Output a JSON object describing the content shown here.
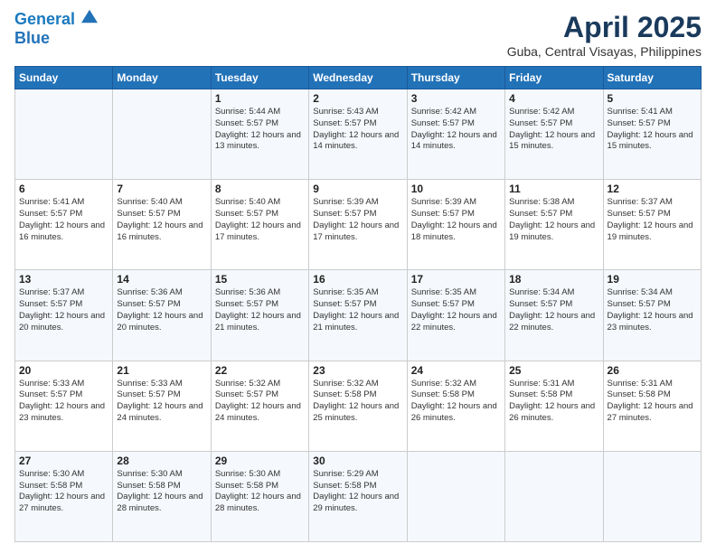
{
  "header": {
    "logo_line1": "General",
    "logo_line2": "Blue",
    "month_year": "April 2025",
    "location": "Guba, Central Visayas, Philippines"
  },
  "days_of_week": [
    "Sunday",
    "Monday",
    "Tuesday",
    "Wednesday",
    "Thursday",
    "Friday",
    "Saturday"
  ],
  "weeks": [
    [
      {
        "day": "",
        "sunrise": "",
        "sunset": "",
        "daylight": ""
      },
      {
        "day": "",
        "sunrise": "",
        "sunset": "",
        "daylight": ""
      },
      {
        "day": "1",
        "sunrise": "Sunrise: 5:44 AM",
        "sunset": "Sunset: 5:57 PM",
        "daylight": "Daylight: 12 hours and 13 minutes."
      },
      {
        "day": "2",
        "sunrise": "Sunrise: 5:43 AM",
        "sunset": "Sunset: 5:57 PM",
        "daylight": "Daylight: 12 hours and 14 minutes."
      },
      {
        "day": "3",
        "sunrise": "Sunrise: 5:42 AM",
        "sunset": "Sunset: 5:57 PM",
        "daylight": "Daylight: 12 hours and 14 minutes."
      },
      {
        "day": "4",
        "sunrise": "Sunrise: 5:42 AM",
        "sunset": "Sunset: 5:57 PM",
        "daylight": "Daylight: 12 hours and 15 minutes."
      },
      {
        "day": "5",
        "sunrise": "Sunrise: 5:41 AM",
        "sunset": "Sunset: 5:57 PM",
        "daylight": "Daylight: 12 hours and 15 minutes."
      }
    ],
    [
      {
        "day": "6",
        "sunrise": "Sunrise: 5:41 AM",
        "sunset": "Sunset: 5:57 PM",
        "daylight": "Daylight: 12 hours and 16 minutes."
      },
      {
        "day": "7",
        "sunrise": "Sunrise: 5:40 AM",
        "sunset": "Sunset: 5:57 PM",
        "daylight": "Daylight: 12 hours and 16 minutes."
      },
      {
        "day": "8",
        "sunrise": "Sunrise: 5:40 AM",
        "sunset": "Sunset: 5:57 PM",
        "daylight": "Daylight: 12 hours and 17 minutes."
      },
      {
        "day": "9",
        "sunrise": "Sunrise: 5:39 AM",
        "sunset": "Sunset: 5:57 PM",
        "daylight": "Daylight: 12 hours and 17 minutes."
      },
      {
        "day": "10",
        "sunrise": "Sunrise: 5:39 AM",
        "sunset": "Sunset: 5:57 PM",
        "daylight": "Daylight: 12 hours and 18 minutes."
      },
      {
        "day": "11",
        "sunrise": "Sunrise: 5:38 AM",
        "sunset": "Sunset: 5:57 PM",
        "daylight": "Daylight: 12 hours and 19 minutes."
      },
      {
        "day": "12",
        "sunrise": "Sunrise: 5:37 AM",
        "sunset": "Sunset: 5:57 PM",
        "daylight": "Daylight: 12 hours and 19 minutes."
      }
    ],
    [
      {
        "day": "13",
        "sunrise": "Sunrise: 5:37 AM",
        "sunset": "Sunset: 5:57 PM",
        "daylight": "Daylight: 12 hours and 20 minutes."
      },
      {
        "day": "14",
        "sunrise": "Sunrise: 5:36 AM",
        "sunset": "Sunset: 5:57 PM",
        "daylight": "Daylight: 12 hours and 20 minutes."
      },
      {
        "day": "15",
        "sunrise": "Sunrise: 5:36 AM",
        "sunset": "Sunset: 5:57 PM",
        "daylight": "Daylight: 12 hours and 21 minutes."
      },
      {
        "day": "16",
        "sunrise": "Sunrise: 5:35 AM",
        "sunset": "Sunset: 5:57 PM",
        "daylight": "Daylight: 12 hours and 21 minutes."
      },
      {
        "day": "17",
        "sunrise": "Sunrise: 5:35 AM",
        "sunset": "Sunset: 5:57 PM",
        "daylight": "Daylight: 12 hours and 22 minutes."
      },
      {
        "day": "18",
        "sunrise": "Sunrise: 5:34 AM",
        "sunset": "Sunset: 5:57 PM",
        "daylight": "Daylight: 12 hours and 22 minutes."
      },
      {
        "day": "19",
        "sunrise": "Sunrise: 5:34 AM",
        "sunset": "Sunset: 5:57 PM",
        "daylight": "Daylight: 12 hours and 23 minutes."
      }
    ],
    [
      {
        "day": "20",
        "sunrise": "Sunrise: 5:33 AM",
        "sunset": "Sunset: 5:57 PM",
        "daylight": "Daylight: 12 hours and 23 minutes."
      },
      {
        "day": "21",
        "sunrise": "Sunrise: 5:33 AM",
        "sunset": "Sunset: 5:57 PM",
        "daylight": "Daylight: 12 hours and 24 minutes."
      },
      {
        "day": "22",
        "sunrise": "Sunrise: 5:32 AM",
        "sunset": "Sunset: 5:57 PM",
        "daylight": "Daylight: 12 hours and 24 minutes."
      },
      {
        "day": "23",
        "sunrise": "Sunrise: 5:32 AM",
        "sunset": "Sunset: 5:58 PM",
        "daylight": "Daylight: 12 hours and 25 minutes."
      },
      {
        "day": "24",
        "sunrise": "Sunrise: 5:32 AM",
        "sunset": "Sunset: 5:58 PM",
        "daylight": "Daylight: 12 hours and 26 minutes."
      },
      {
        "day": "25",
        "sunrise": "Sunrise: 5:31 AM",
        "sunset": "Sunset: 5:58 PM",
        "daylight": "Daylight: 12 hours and 26 minutes."
      },
      {
        "day": "26",
        "sunrise": "Sunrise: 5:31 AM",
        "sunset": "Sunset: 5:58 PM",
        "daylight": "Daylight: 12 hours and 27 minutes."
      }
    ],
    [
      {
        "day": "27",
        "sunrise": "Sunrise: 5:30 AM",
        "sunset": "Sunset: 5:58 PM",
        "daylight": "Daylight: 12 hours and 27 minutes."
      },
      {
        "day": "28",
        "sunrise": "Sunrise: 5:30 AM",
        "sunset": "Sunset: 5:58 PM",
        "daylight": "Daylight: 12 hours and 28 minutes."
      },
      {
        "day": "29",
        "sunrise": "Sunrise: 5:30 AM",
        "sunset": "Sunset: 5:58 PM",
        "daylight": "Daylight: 12 hours and 28 minutes."
      },
      {
        "day": "30",
        "sunrise": "Sunrise: 5:29 AM",
        "sunset": "Sunset: 5:58 PM",
        "daylight": "Daylight: 12 hours and 29 minutes."
      },
      {
        "day": "",
        "sunrise": "",
        "sunset": "",
        "daylight": ""
      },
      {
        "day": "",
        "sunrise": "",
        "sunset": "",
        "daylight": ""
      },
      {
        "day": "",
        "sunrise": "",
        "sunset": "",
        "daylight": ""
      }
    ]
  ]
}
